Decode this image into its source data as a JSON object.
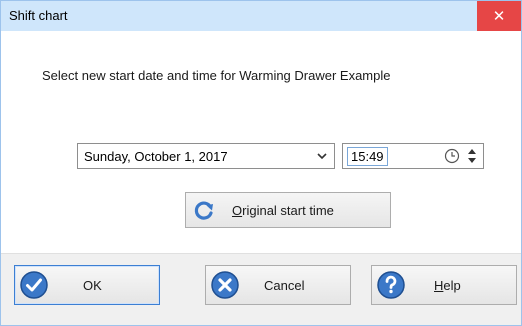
{
  "window": {
    "title": "Shift chart",
    "close_glyph": "✕"
  },
  "prompt": {
    "text": "Select new start date and time for Warming Drawer Example"
  },
  "date_select": {
    "value": "Sunday, October 1, 2017",
    "icon": "chevron-down-icon"
  },
  "time_picker": {
    "value": "15:49",
    "icons": [
      "clock-icon",
      "spin-up-down-icon"
    ]
  },
  "original_button": {
    "label_mnemonic": "O",
    "label_rest": "riginal start time",
    "icon": "refresh-icon"
  },
  "footer": {
    "ok_label": "OK",
    "cancel_label": "Cancel",
    "help_mnemonic": "H",
    "help_rest": "elp"
  },
  "colors": {
    "titlebar": "#cfe6fb",
    "close_button": "#e64646",
    "icon_blue": "#3b78c8",
    "default_border": "#3c7fd3"
  }
}
